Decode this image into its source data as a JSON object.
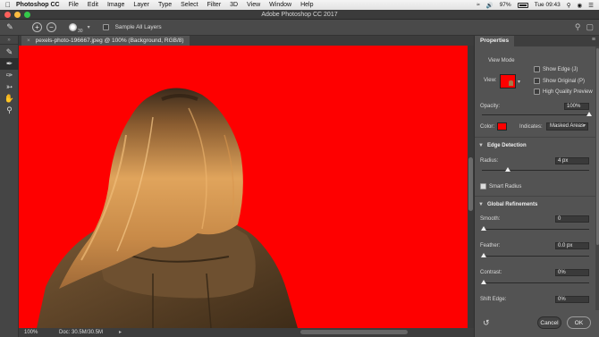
{
  "menubar": {
    "app_name": "Photoshop CC",
    "items": [
      "File",
      "Edit",
      "Image",
      "Layer",
      "Type",
      "Select",
      "Filter",
      "3D",
      "View",
      "Window",
      "Help"
    ],
    "battery": "97%",
    "clock": "Tue 09:43"
  },
  "titlebar": {
    "title": "Adobe Photoshop CC 2017"
  },
  "options": {
    "brush_size": "30",
    "sample_all_layers": "Sample All Layers"
  },
  "document": {
    "tab_title": "pexels-photo-196667.jpeg @ 100% (Background, RGB/8)",
    "zoom": "100%",
    "doc_size": "Doc: 30.5M/30.5M"
  },
  "properties": {
    "tab": "Properties",
    "view_mode": {
      "heading": "View Mode",
      "view_label": "View:",
      "show_edge": "Show Edge (J)",
      "show_original": "Show Original (P)",
      "high_quality_preview": "High Quality Preview"
    },
    "opacity": {
      "label": "Opacity:",
      "value": "100%",
      "level_pct": 100
    },
    "color": {
      "label": "Color:",
      "value": "#fe0000",
      "indicates_label": "Indicates:",
      "indicates_value": "Masked Areas"
    },
    "edge_detection": {
      "heading": "Edge Detection",
      "radius_label": "Radius:",
      "radius_value": "4 px",
      "smart_radius": "Smart Radius"
    },
    "global_refinements": {
      "heading": "Global Refinements",
      "smooth_label": "Smooth:",
      "smooth_value": "0",
      "feather_label": "Feather:",
      "feather_value": "0.0 px",
      "contrast_label": "Contrast:",
      "contrast_value": "0%",
      "shift_edge_label": "Shift Edge:",
      "shift_edge_value": "0%"
    },
    "buttons": {
      "cancel": "Cancel",
      "ok": "OK"
    }
  },
  "colors": {
    "canvas_bg": "#fe0000",
    "ui_panel": "#535353"
  }
}
